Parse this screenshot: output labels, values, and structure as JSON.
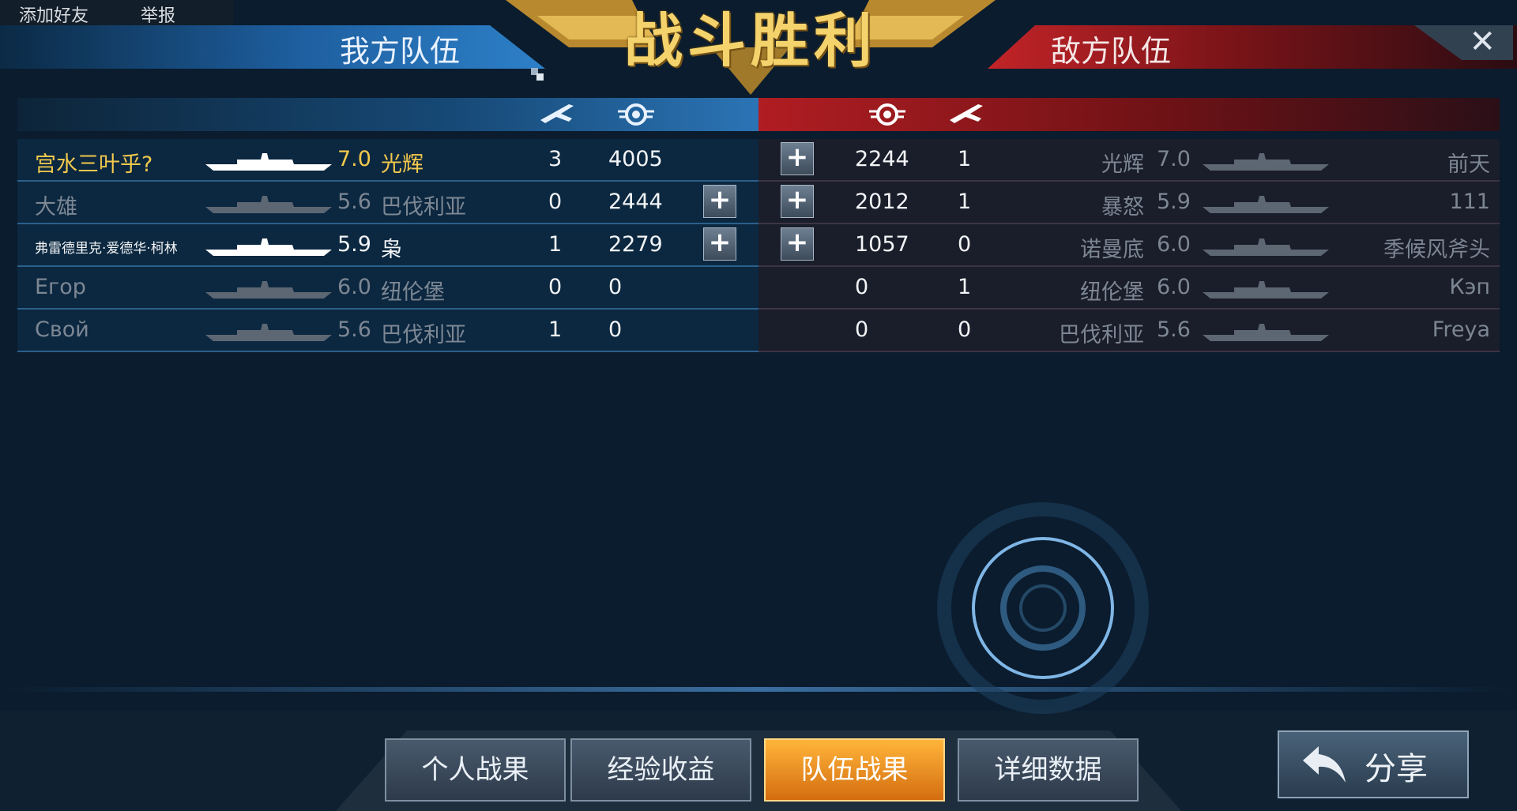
{
  "top_buttons": {
    "add_friend": "添加好友",
    "report": "举报"
  },
  "banner": {
    "title": "战斗胜利"
  },
  "ally_header": "我方队伍",
  "enemy_header": "敌方队伍",
  "ally_rows": [
    {
      "player": "宫水三叶乎?",
      "level": "7.0",
      "ship": "光辉",
      "kills": "3",
      "score": "4005",
      "plus": false,
      "style": "gold"
    },
    {
      "player": "大雄",
      "level": "5.6",
      "ship": "巴伐利亚",
      "kills": "0",
      "score": "2444",
      "plus": true,
      "style": "dim"
    },
    {
      "player": "弗雷德里克·爱德华·柯林",
      "level": "5.9",
      "ship": "枭",
      "kills": "1",
      "score": "2279",
      "plus": true,
      "style": "bright"
    },
    {
      "player": "Егор",
      "level": "6.0",
      "ship": "纽伦堡",
      "kills": "0",
      "score": "0",
      "plus": false,
      "style": "dim"
    },
    {
      "player": "Свой",
      "level": "5.6",
      "ship": "巴伐利亚",
      "kills": "1",
      "score": "0",
      "plus": false,
      "style": "dim"
    }
  ],
  "enemy_rows": [
    {
      "score": "2244",
      "kills": "1",
      "ship": "光辉",
      "level": "7.0",
      "player": "前天",
      "plus": true
    },
    {
      "score": "2012",
      "kills": "1",
      "ship": "暴怒",
      "level": "5.9",
      "player": "111",
      "plus": true
    },
    {
      "score": "1057",
      "kills": "0",
      "ship": "诺曼底",
      "level": "6.0",
      "player": "季候风斧头",
      "plus": true
    },
    {
      "score": "0",
      "kills": "1",
      "ship": "纽伦堡",
      "level": "6.0",
      "player": "Кэп",
      "plus": false
    },
    {
      "score": "0",
      "kills": "0",
      "ship": "巴伐利亚",
      "level": "5.6",
      "player": "Freya",
      "plus": false
    }
  ],
  "tabs": [
    "个人战果",
    "经验收益",
    "队伍战果",
    "详细数据"
  ],
  "active_tab": "队伍战果",
  "share": "分享",
  "plus_glyph": "+",
  "close_glyph": "✕",
  "colors": {
    "ally": "#1e5fa0",
    "enemy": "#c22428",
    "gold": "#f2c94c",
    "active_tab": "#f29a2e"
  }
}
